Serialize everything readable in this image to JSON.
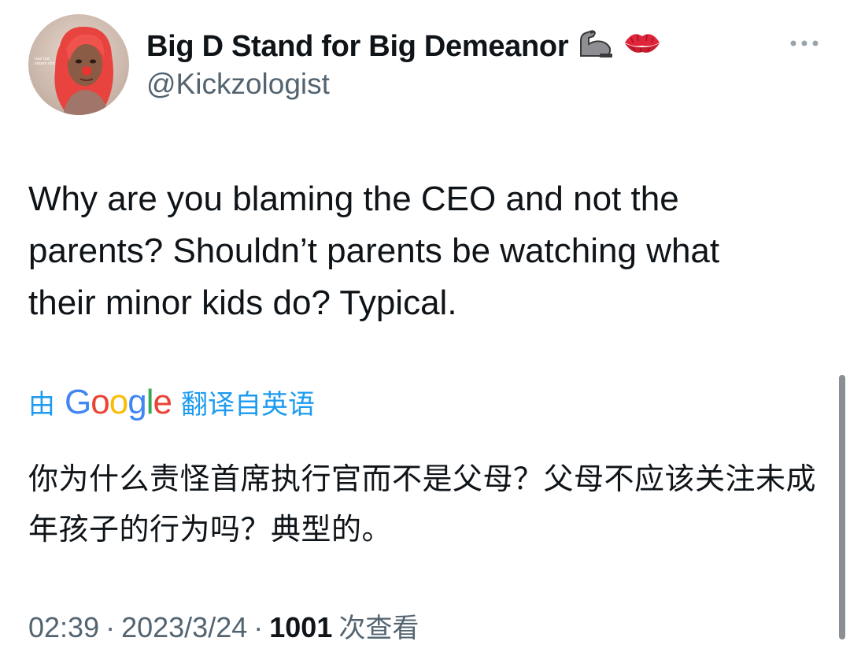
{
  "tweet": {
    "display_name": "Big D Stand for Big Demeanor",
    "name_emojis": [
      "flexed-biceps-icon",
      "kiss-mark-icon"
    ],
    "handle": "@Kickzologist",
    "avatar_caption": "real hot\nsteam shit",
    "text": "Why are you blaming the CEO and not the\nparents? Shouldn’t parents be watching what\ntheir minor kids do? Typical.",
    "translation": {
      "by_label": "由",
      "provider": "Google",
      "from_label": "翻译自英语",
      "text": "你为什么责怪首席执行官而不是父母？父母不应该关注未成年孩子的行为吗？典型的。"
    },
    "meta": {
      "time": "02:39",
      "separator": "·",
      "date": "2023/3/24",
      "views_count": "1001",
      "views_label": "次查看"
    }
  },
  "colors": {
    "link": "#1d9bf0",
    "secondary_text": "#536471",
    "primary_text": "#0f1419",
    "google_blue": "#4285f4",
    "google_red": "#ea4335",
    "google_yellow": "#fbbc05",
    "google_green": "#34a853"
  }
}
